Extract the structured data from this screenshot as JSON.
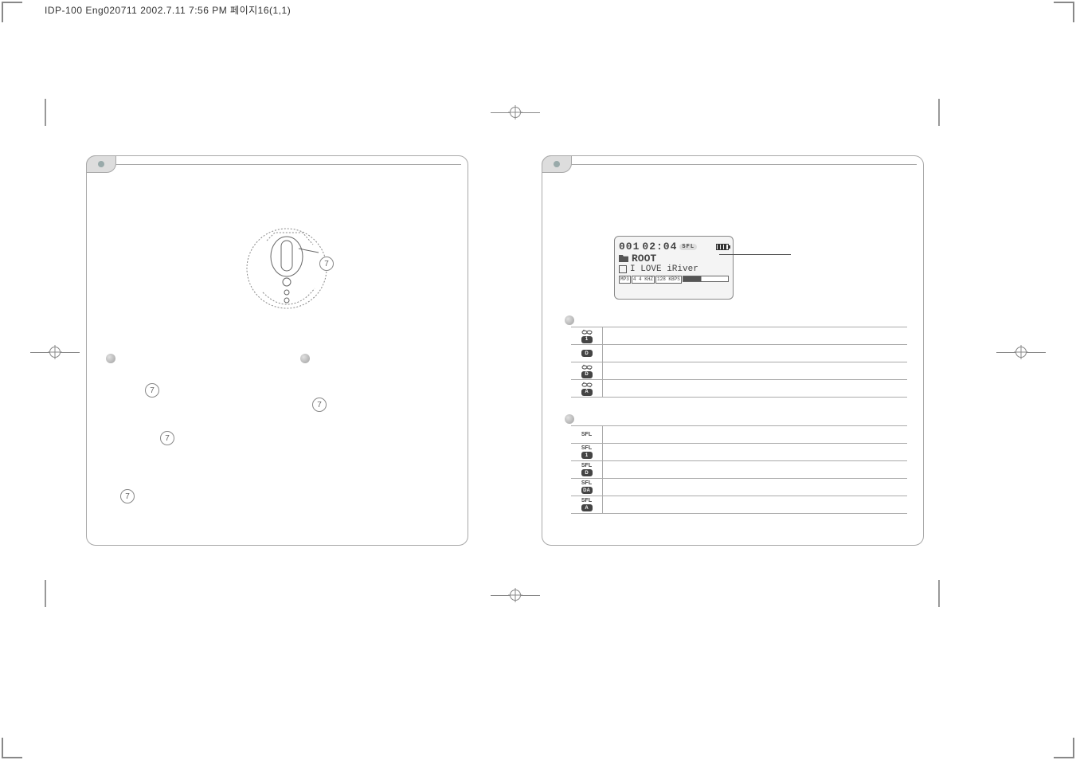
{
  "header": "IDP-100 Eng020711  2002.7.11 7:56 PM  페이지16(1,1)",
  "left": {
    "callout_number": "7"
  },
  "lcd": {
    "track": "001",
    "time": "02:04",
    "mode_badge": "SFL",
    "folder": "ROOT",
    "song": "I LOVE iRiver",
    "codec": "MP3",
    "khz": "4 4 KHZ",
    "kbps": "128 KBPS"
  },
  "repeat_table": [
    {
      "icon_type": "loop",
      "chip": "1",
      "desc": ""
    },
    {
      "icon_type": "",
      "chip": "D",
      "desc": ""
    },
    {
      "icon_type": "loop",
      "chip": "D",
      "desc": ""
    },
    {
      "icon_type": "loop",
      "chip": "A",
      "desc": ""
    }
  ],
  "shuffle_table": [
    {
      "label": "SFL",
      "chip": "",
      "desc": ""
    },
    {
      "label": "SFL",
      "chip": "1",
      "desc": ""
    },
    {
      "label": "SFL",
      "chip": "D",
      "desc": ""
    },
    {
      "label": "SFL",
      "chip": "DA",
      "desc": ""
    },
    {
      "label": "SFL",
      "chip": "A",
      "desc": ""
    }
  ]
}
